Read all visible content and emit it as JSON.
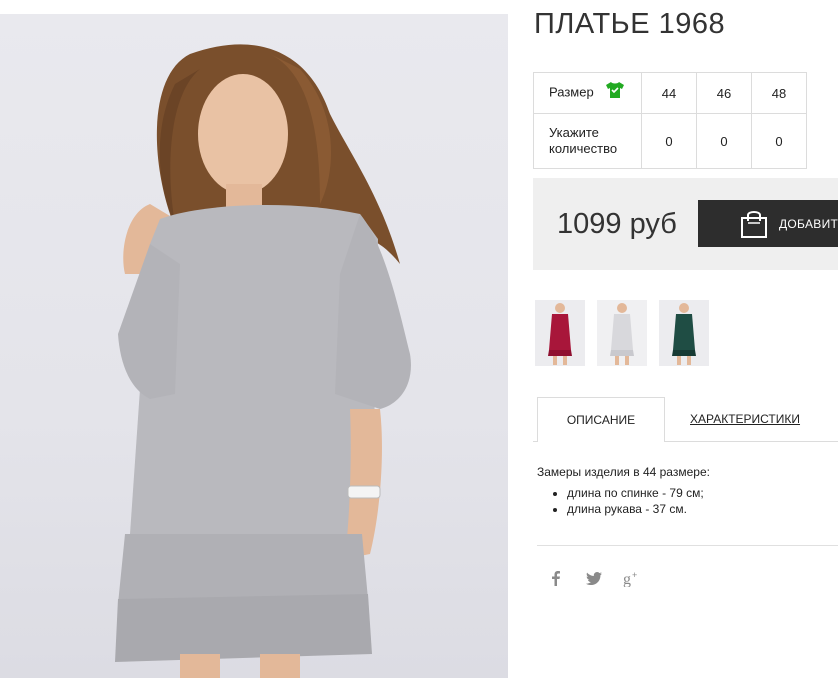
{
  "product": {
    "title": "ПЛАТЬЕ 1968",
    "price": "1099 руб",
    "add_to_cart_label": "ДОБАВИТ"
  },
  "size_table": {
    "size_label": "Размер",
    "qty_label_line1": "Укажите",
    "qty_label_line2": "количество",
    "sizes": [
      "44",
      "46",
      "48"
    ],
    "quantities": [
      "0",
      "0",
      "0"
    ],
    "tshirt_icon_color": "#22aa22"
  },
  "thumbnails": [
    {
      "icon": "burgundy-dress-thumbnail",
      "color": "#a8163a"
    },
    {
      "icon": "grey-dress-thumbnail",
      "color": "#d8d8dc"
    },
    {
      "icon": "green-dress-thumbnail",
      "color": "#1f4d44"
    }
  ],
  "tabs": {
    "description": "ОПИСАНИЕ",
    "characteristics": "ХАРАКТЕРИСТИКИ"
  },
  "description": {
    "intro": "Замеры изделия в 44 размере:",
    "items": [
      "длина по спинке - 79 см;",
      "длина рукава - 37 см."
    ]
  },
  "social": [
    "facebook-icon",
    "twitter-icon",
    "google-plus-icon"
  ]
}
